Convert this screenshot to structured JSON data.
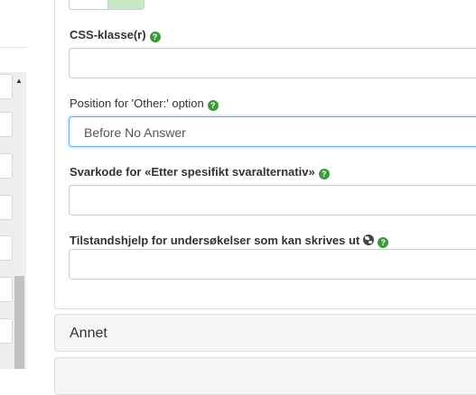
{
  "form": {
    "css_label": "CSS-klasse(r)",
    "other_position_label": "Position for 'Other:' option",
    "other_position_value": "Before No Answer",
    "answer_code_label": "Svarkode for «Etter spesifikt svaralternativ»",
    "printable_help_label": "Tilstandshjelp for undersøkelser som kan skrives ut",
    "help_icon_glyph": "?"
  },
  "accordion": {
    "annet_label": "Annet"
  },
  "colors": {
    "help_icon": "#3c9a3c",
    "focus_border": "#66afe9",
    "toggle_on": "#c9e8c7"
  },
  "icons": [
    "question-circle-icon",
    "globe-icon",
    "scroll-up-arrow-icon"
  ]
}
